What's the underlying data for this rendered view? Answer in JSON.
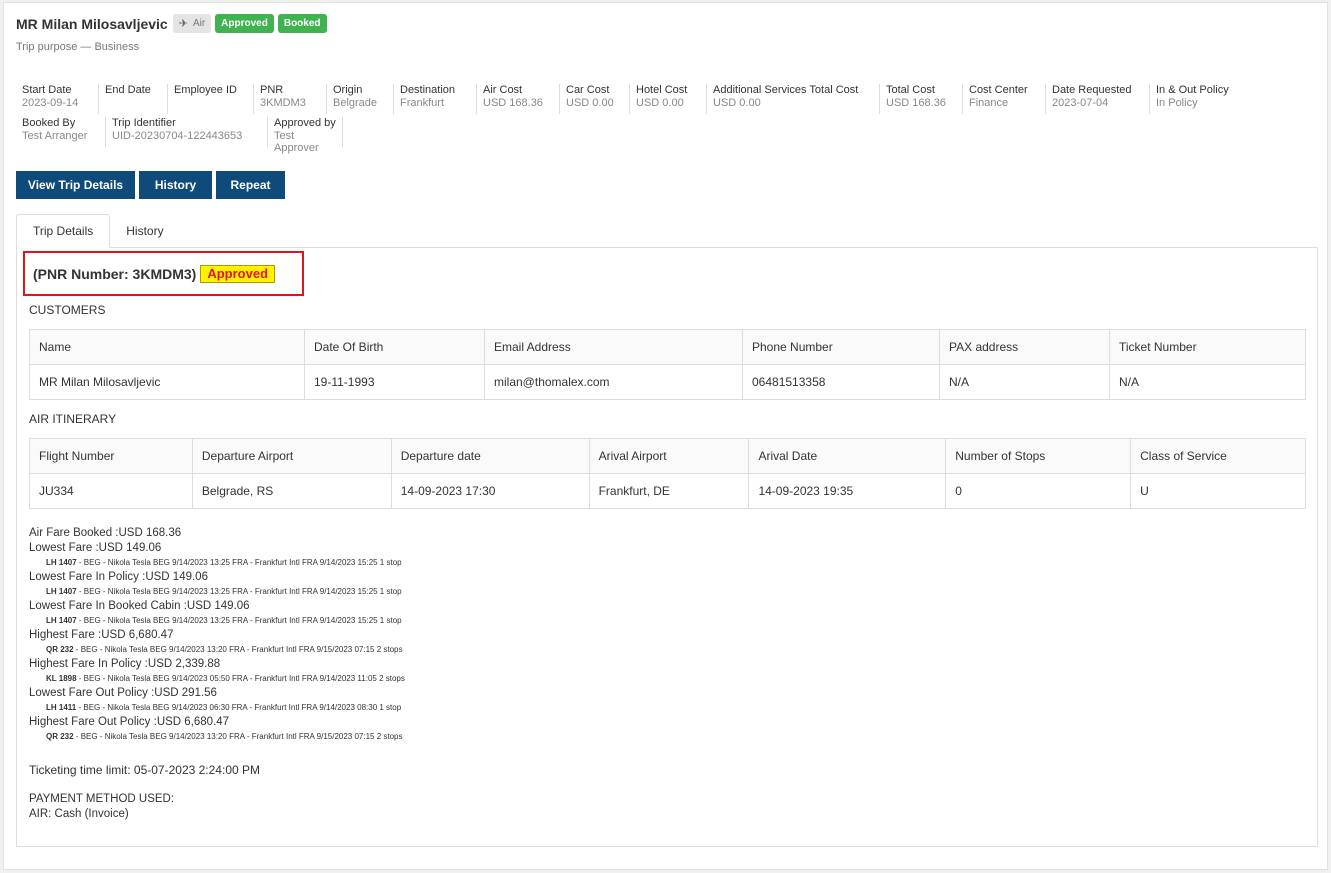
{
  "header": {
    "title": "MR Milan Milosavljevic",
    "mode_badge": "Air",
    "status_badges": [
      "Approved",
      "Booked"
    ],
    "subtitle": "Trip purpose — Business"
  },
  "info_row1": [
    {
      "label": "Start Date",
      "value": "2023-09-14"
    },
    {
      "label": "End Date",
      "value": ""
    },
    {
      "label": "Employee ID",
      "value": ""
    },
    {
      "label": "PNR",
      "value": "3KMDM3"
    },
    {
      "label": "Origin",
      "value": "Belgrade"
    },
    {
      "label": "Destination",
      "value": "Frankfurt"
    },
    {
      "label": "Air Cost",
      "value": "USD 168.36"
    },
    {
      "label": "Car Cost",
      "value": "USD 0.00"
    },
    {
      "label": "Hotel Cost",
      "value": "USD 0.00"
    },
    {
      "label": "Additional Services Total Cost",
      "value": "USD 0.00"
    },
    {
      "label": "Total Cost",
      "value": "USD 168.36"
    },
    {
      "label": "Cost Center",
      "value": "Finance"
    },
    {
      "label": "Date Requested",
      "value": "2023-07-04"
    },
    {
      "label": "In & Out Policy",
      "value": "In Policy"
    }
  ],
  "info_row2": [
    {
      "label": "Booked By",
      "value": "Test Arranger"
    },
    {
      "label": "Trip Identifier",
      "value": "UID-20230704-122443653"
    },
    {
      "label": "Approved by",
      "value": "Test Approver"
    }
  ],
  "buttons": {
    "view_trip_details": "View Trip Details",
    "history": "History",
    "repeat": "Repeat"
  },
  "tabs": [
    "Trip Details",
    "History"
  ],
  "pnr": {
    "text": "(PNR Number: 3KMDM3)",
    "status": "Approved"
  },
  "customers": {
    "title": "CUSTOMERS",
    "columns": [
      "Name",
      "Date Of Birth",
      "Email Address",
      "Phone Number",
      "PAX address",
      "Ticket Number"
    ],
    "rows": [
      [
        "MR Milan Milosavljevic",
        "19-11-1993",
        "milan@thomalex.com",
        "06481513358",
        "N/A",
        "N/A"
      ]
    ]
  },
  "itinerary": {
    "title": "AIR ITINERARY",
    "columns": [
      "Flight Number",
      "Departure Airport",
      "Departure date",
      "Arival Airport",
      "Arival Date",
      "Number of Stops",
      "Class of Service"
    ],
    "rows": [
      [
        "JU334",
        "Belgrade, RS",
        "14-09-2023 17:30",
        "Frankfurt, DE",
        "14-09-2023 19:35",
        "0",
        "U"
      ]
    ]
  },
  "fares": [
    {
      "label": "Air Fare Booked :",
      "value": "USD 168.36",
      "flight": "",
      "detail": ""
    },
    {
      "label": "Lowest Fare :",
      "value": "USD 149.06",
      "flight": "LH 1407",
      "detail": " - BEG - Nikola Tesla BEG 9/14/2023 13:25 FRA - Frankfurt Intl FRA 9/14/2023 15:25 1 stop"
    },
    {
      "label": "Lowest Fare In Policy :",
      "value": "USD 149.06",
      "flight": "LH 1407",
      "detail": " - BEG - Nikola Tesla BEG 9/14/2023 13:25 FRA - Frankfurt Intl FRA 9/14/2023 15:25 1 stop"
    },
    {
      "label": "Lowest Fare In Booked Cabin :",
      "value": "USD 149.06",
      "flight": "LH 1407",
      "detail": " - BEG - Nikola Tesla BEG 9/14/2023 13:25 FRA - Frankfurt Intl FRA 9/14/2023 15:25 1 stop"
    },
    {
      "label": "Highest Fare :",
      "value": "USD 6,680.47",
      "flight": "QR 232",
      "detail": " - BEG - Nikola Tesla BEG 9/14/2023 13:20 FRA - Frankfurt Intl FRA 9/15/2023 07:15 2 stops"
    },
    {
      "label": "Highest Fare In Policy :",
      "value": "USD 2,339.88",
      "flight": "KL 1898",
      "detail": " - BEG - Nikola Tesla BEG 9/14/2023 05:50 FRA - Frankfurt Intl FRA 9/14/2023 11:05 2 stops"
    },
    {
      "label": "Lowest Fare Out Policy :",
      "value": "USD 291.56",
      "flight": "LH 1411",
      "detail": " - BEG - Nikola Tesla BEG 9/14/2023 06:30 FRA - Frankfurt Intl FRA 9/14/2023 08:30 1 stop"
    },
    {
      "label": "Highest Fare Out Policy :",
      "value": "USD 6,680.47",
      "flight": "QR 232",
      "detail": " - BEG - Nikola Tesla BEG 9/14/2023 13:20 FRA - Frankfurt Intl FRA 9/15/2023 07:15 2 stops"
    }
  ],
  "ticketing_time_limit": "Ticketing time limit: 05-07-2023 2:24:00 PM",
  "payment": {
    "title": "PAYMENT METHOD USED:",
    "value": "AIR: Cash (Invoice)"
  }
}
